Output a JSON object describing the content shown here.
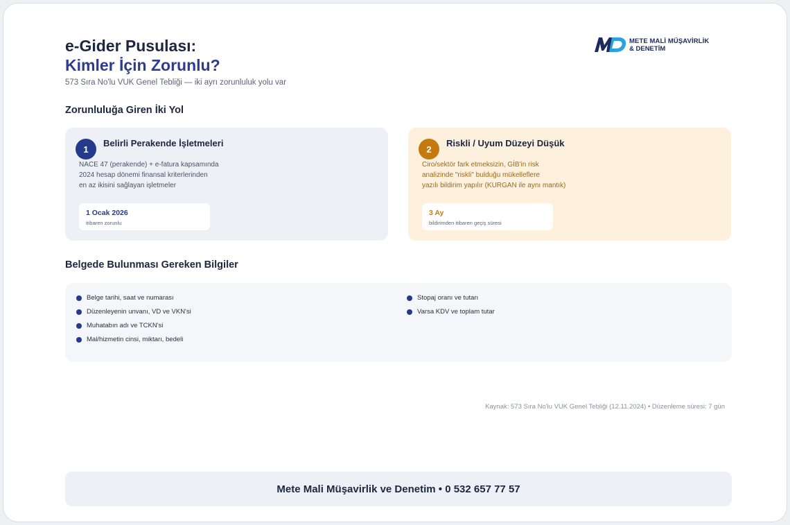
{
  "header": {
    "title_line1": "e-Gider Pusulası:",
    "title_line2": "Kimler İçin Zorunlu?",
    "subtitle": "573 Sıra No'lu VUK Genel Tebliği — iki ayrı zorunluluk yolu var"
  },
  "logo": {
    "mark": "MD",
    "line1": "METE MALİ MÜŞAVİRLİK",
    "line2": "& DENETİM"
  },
  "paths_section": {
    "title": "Zorunluluğa Giren İki Yol",
    "items": [
      {
        "number": "1",
        "title": "Belirli Perakende İşletmeleri",
        "desc_lines": [
          "NACE 47 (perakende) + e-fatura kapsamında",
          "2024 hesap dönemi finansal kriterlerinden",
          "en az ikisini sağlayan işletmeler"
        ],
        "pill_main": "1 Ocak 2026",
        "pill_sub": "itibaren zorunlu"
      },
      {
        "number": "2",
        "title": "Riskli / Uyum Düzeyi Düşük",
        "desc_lines": [
          "Ciro/sektör fark etmeksizin, GİB'in risk",
          "analizinde \"riskli\" bulduğu mükelleflere",
          "yazılı bildirim yapılır (KURGAN ile aynı mantık)"
        ],
        "pill_main": "3 Ay",
        "pill_sub": "bildirimden itibaren geçiş süresi"
      }
    ]
  },
  "info_section": {
    "title": "Belgede Bulunması Gereken Bilgiler",
    "col1": [
      "Belge tarihi, saat ve numarası",
      "Düzenleyenin unvanı, VD ve VKN'si",
      "Muhatabın adı ve TCKN'si",
      "Mal/hizmetin cinsi, miktarı, bedeli"
    ],
    "col2": [
      "Stopaj oranı ve tutarı",
      "Varsa KDV ve toplam tutar"
    ]
  },
  "source": "Kaynak: 573 Sıra No'lu VUK Genel Tebliği (12.11.2024) • Düzenleme süresi: 7 gün",
  "footer": "Mete Mali Müşavirlik ve Denetim • 0 532 657 77 57",
  "colors": {
    "navy": "#263a8c",
    "amber": "#c47a10",
    "card1_bg": "#edf0f5",
    "card2_bg": "#fdf0dc"
  }
}
